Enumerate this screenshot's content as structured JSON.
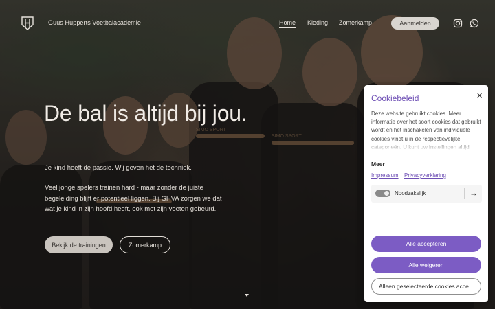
{
  "header": {
    "brand": "Guus Hupperts Voetbalacademie",
    "nav": [
      "Home",
      "Kleding",
      "Zomerkamp"
    ],
    "signin_label": "Aanmelden"
  },
  "hero": {
    "title": "De bal is altijd bij jou.",
    "subtitle": "Je kind heeft de passie. Wij geven het de techniek.",
    "paragraph": "Veel jonge spelers trainen hard - maar zonder de juiste begeleiding blijft er potentieel liggen. Bij GHVA zorgen we dat wat je kind in zijn hoofd heeft, ook met zijn voeten gebeurd.",
    "primary_button": "Bekijk de trainingen",
    "secondary_button": "Zomerkamp",
    "shirt_print": "SIMO SPORT"
  },
  "cookie": {
    "title": "Cookiebeleid",
    "text": "Deze website gebruikt cookies. Meer informatie over het soort cookies dat gebruikt wordt en het inschakelen van individuele cookies vindt u in de respectievelijke categorieën. U kunt uw instellingen altijd",
    "more_label": "Meer",
    "links": [
      "Impressum",
      "Privacyverklaring"
    ],
    "category_label": "Noodzakelijk",
    "accept_all": "Alle accepteren",
    "reject_all": "Alle weigeren",
    "accept_selected": "Alleen geselecteerde cookies acce..."
  },
  "colors": {
    "accent": "#7c5cc4",
    "title": "#6e4fb5"
  },
  "icons": [
    "logo-icon",
    "instagram-icon",
    "whatsapp-icon",
    "close-icon",
    "arrow-right-icon",
    "chevron-down-icon"
  ]
}
